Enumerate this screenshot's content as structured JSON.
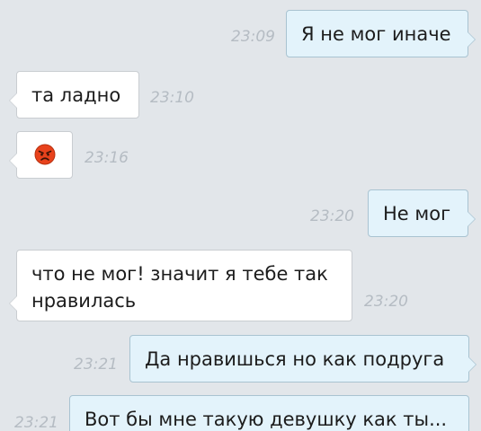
{
  "messages": [
    {
      "direction": "out",
      "text": "Я не мог иначе",
      "time": "23:09"
    },
    {
      "direction": "in",
      "text": "та ладно",
      "time": "23:10"
    },
    {
      "direction": "in",
      "emoji": "angry-face-emoji",
      "time": "23:16"
    },
    {
      "direction": "out",
      "text": "Не мог",
      "time": "23:20"
    },
    {
      "direction": "in",
      "text": "что не мог! значит я тебе так\nнравилась",
      "time": "23:20"
    },
    {
      "direction": "out",
      "text": "Да нравишься но как подруга",
      "time": "23:21"
    },
    {
      "direction": "out",
      "text": "Вот бы мне такую девушку как ты...",
      "time": "23:21"
    }
  ],
  "colors": {
    "background": "#e2e6ea",
    "incoming_bubble": "#ffffff",
    "outgoing_bubble": "#e3f3fb",
    "timestamp": "#b5bcc3",
    "emoji_face": "#e8421c"
  }
}
